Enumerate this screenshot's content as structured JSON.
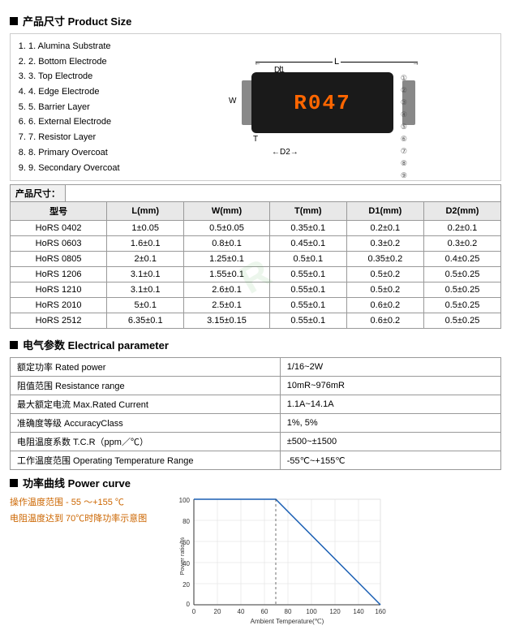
{
  "sections": {
    "product_size": {
      "icon": "■",
      "title": "产品尺寸 Product Size",
      "components": [
        "1. Alumina Substrate",
        "2. Bottom Electrode",
        "3. Top Electrode",
        "4. Edge Electrode",
        "5. Barrier Layer",
        "6. External Electrode",
        "7. Resistor Layer",
        "8. Primary Overcoat",
        "9. Secondary Overcoat"
      ],
      "resistor_text": "R047",
      "dimensions_label": "产品尺寸：",
      "table": {
        "headers": [
          "型号",
          "L(mm)",
          "W(mm)",
          "T(mm)",
          "D1(mm)",
          "D2(mm)"
        ],
        "rows": [
          [
            "HoRS 0402",
            "1±0.05",
            "0.5±0.05",
            "0.35±0.1",
            "0.2±0.1",
            "0.2±0.1"
          ],
          [
            "HoRS 0603",
            "1.6±0.1",
            "0.8±0.1",
            "0.45±0.1",
            "0.3±0.2",
            "0.3±0.2"
          ],
          [
            "HoRS 0805",
            "2±0.1",
            "1.25±0.1",
            "0.5±0.1",
            "0.35±0.2",
            "0.4±0.25"
          ],
          [
            "HoRS 1206",
            "3.1±0.1",
            "1.55±0.1",
            "0.55±0.1",
            "0.5±0.2",
            "0.5±0.25"
          ],
          [
            "HoRS 1210",
            "3.1±0.1",
            "2.6±0.1",
            "0.55±0.1",
            "0.5±0.2",
            "0.5±0.25"
          ],
          [
            "HoRS 2010",
            "5±0.1",
            "2.5±0.1",
            "0.55±0.1",
            "0.6±0.2",
            "0.5±0.25"
          ],
          [
            "HoRS 2512",
            "6.35±0.1",
            "3.15±0.15",
            "0.55±0.1",
            "0.6±0.2",
            "0.5±0.25"
          ]
        ]
      }
    },
    "electrical": {
      "icon": "■",
      "title": "电气参数 Electrical parameter",
      "params": [
        [
          "额定功率 Rated power",
          "1/16~2W"
        ],
        [
          "阻值范围 Resistance range",
          "10mR~976mR"
        ],
        [
          "最大额定电流 Max.Rated Current",
          "1.1A~14.1A"
        ],
        [
          "准确度等级 AccuracyClass",
          "1%, 5%"
        ],
        [
          "电阻温度系数 T.C.R（ppm／℃）",
          "±500~±1500"
        ],
        [
          "工作温度范围 Operating Temperature Range",
          "-55℃~+155℃"
        ]
      ]
    },
    "power_curve": {
      "icon": "■",
      "title": "功率曲线 Power curve",
      "text_line1": "操作温度范围 - 55 ～+155 ℃",
      "text_line2": "电阻温度达到 70℃时降功率示意图",
      "chart": {
        "y_label": "Power ratio/%",
        "x_label": "Ambient Temperature(℃)",
        "y_max": 100,
        "y_ticks": [
          0,
          20,
          40,
          60,
          80,
          100
        ],
        "x_ticks": [
          0,
          20,
          40,
          60,
          80,
          100,
          120,
          140,
          160
        ],
        "line_points": [
          [
            0,
            100
          ],
          [
            70,
            100
          ],
          [
            155,
            0
          ]
        ]
      }
    }
  }
}
